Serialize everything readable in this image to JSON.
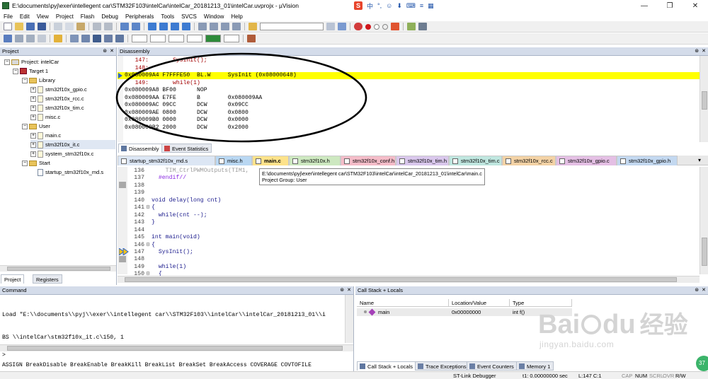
{
  "window": {
    "title": "E:\\documents\\pyj\\exer\\intellegent car\\STM32F103\\intelCar\\intelCar_20181213_01\\intelCar.uvprojx - µVision",
    "controls": [
      "—",
      "❐",
      "✕"
    ]
  },
  "ime": {
    "logo": "S",
    "lang": "中",
    "items": [
      "°,",
      "☺",
      "⬇",
      "⌨",
      "≡",
      "▦"
    ]
  },
  "menu": [
    "File",
    "Edit",
    "View",
    "Project",
    "Flash",
    "Debug",
    "Peripherals",
    "Tools",
    "SVCS",
    "Window",
    "Help"
  ],
  "project": {
    "header": "Project",
    "root": "Project: intelCar",
    "target": "Target 1",
    "groups": [
      {
        "name": "Library",
        "files": [
          "stm32f10x_gpio.c",
          "stm32f10x_rcc.c",
          "stm32f10x_tim.c",
          "misc.c"
        ]
      },
      {
        "name": "User",
        "files": [
          "main.c",
          "stm32f10x_it.c",
          "system_stm32f10x.c"
        ]
      },
      {
        "name": "Start",
        "files": [
          "startup_stm32f10x_md.s"
        ]
      }
    ],
    "bottom_tabs": [
      "Project",
      "Registers"
    ]
  },
  "disassembly": {
    "header": "Disassembly",
    "lines": [
      {
        "text": "   147:       SysInit();",
        "kind": "src"
      },
      {
        "text": "   148:",
        "kind": "src"
      },
      {
        "text": "0x080009A4 F7FFFE50  BL.W     SysInit (0x08000648)",
        "kind": "current"
      },
      {
        "text": "   149:       while(1)",
        "kind": "src"
      },
      {
        "text": "0x080009A8 BF00      NOP",
        "kind": "asm"
      },
      {
        "text": "0x080009AA E7FE      B        0x080009AA",
        "kind": "asm"
      },
      {
        "text": "0x080009AC 09CC      DCW      0x09CC",
        "kind": "asm"
      },
      {
        "text": "0x080009AE 0800      DCW      0x0800",
        "kind": "asm"
      },
      {
        "text": "0x080009B0 0000      DCW      0x0000",
        "kind": "asm"
      },
      {
        "text": "0x080009B2 2000      DCW      0x2000",
        "kind": "asm"
      }
    ],
    "tabs": [
      "Disassembly",
      "Event Statistics"
    ]
  },
  "file_tabs": [
    {
      "label": "startup_stm32f10x_md.s",
      "color": "#dce6f4"
    },
    {
      "label": "misc.h",
      "color": "#b9d7f2"
    },
    {
      "label": "main.c",
      "color": "#fde28a",
      "active": true
    },
    {
      "label": "stm32f10x.h",
      "color": "#cde8c0"
    },
    {
      "label": "stm32f10x_conf.h",
      "color": "#f4bcc8"
    },
    {
      "label": "stm32f10x_tim.h",
      "color": "#d9c7ec"
    },
    {
      "label": "stm32f10x_tim.c",
      "color": "#bfe6df"
    },
    {
      "label": "stm32f10x_rcc.c",
      "color": "#f3d2a5"
    },
    {
      "label": "stm32f10x_gpio.c",
      "color": "#e4bfe4"
    },
    {
      "label": "stm32f10x_gpio.h",
      "color": "#c3d8f0"
    }
  ],
  "editor": {
    "lines": [
      {
        "n": "136",
        "pre": "    ",
        "code": "TIM_CtrlPWMOutputs(TIM1,",
        "style": "faded"
      },
      {
        "n": "137",
        "pre": "  ",
        "code": "#endif//",
        "style": "pp"
      },
      {
        "n": "138",
        "pre": "",
        "code": "",
        "style": "plain"
      },
      {
        "n": "139",
        "pre": "",
        "code": "",
        "style": "plain"
      },
      {
        "n": "140",
        "pre": "",
        "code": "void delay(long cnt)",
        "style": "plain"
      },
      {
        "n": "141",
        "pre": "",
        "code": "{",
        "style": "plain"
      },
      {
        "n": "142",
        "pre": "  ",
        "code": "while(cnt --);",
        "style": "plain"
      },
      {
        "n": "143",
        "pre": "",
        "code": "}",
        "style": "plain"
      },
      {
        "n": "144",
        "pre": "",
        "code": "",
        "style": "plain"
      },
      {
        "n": "145",
        "pre": "",
        "code": "int main(void)",
        "style": "plain"
      },
      {
        "n": "146",
        "pre": "",
        "code": "{",
        "style": "plain"
      },
      {
        "n": "147",
        "pre": "  ",
        "code": "SysInit();",
        "style": "plain"
      },
      {
        "n": "148",
        "pre": "",
        "code": "",
        "style": "plain"
      },
      {
        "n": "149",
        "pre": "  ",
        "code": "while(1)",
        "style": "plain"
      },
      {
        "n": "150",
        "pre": "  ",
        "code": "{",
        "style": "plain"
      }
    ],
    "tooltip": {
      "path": "E:\\documents\\pyj\\exer\\intellegent car\\STM32F103\\intelCar\\intelCar_20181213_01\\intelCar\\main.c",
      "group": "Project Group: User"
    }
  },
  "command": {
    "header": "Command",
    "output": [
      "Load \"E:\\\\documents\\\\pyj\\\\exer\\\\intellegent car\\\\STM32F103\\\\intelCar\\\\intelCar_20181213_01\\\\i",
      "BS \\\\intelCar\\stm32f10x_it.c\\150, 1"
    ],
    "prompt": ">",
    "hint": "ASSIGN BreakDisable BreakEnable BreakKill BreakList BreakSet BreakAccess COVERAGE COVTOFILE"
  },
  "callstack": {
    "header": "Call Stack + Locals",
    "columns": [
      "Name",
      "Location/Value",
      "Type"
    ],
    "rows": [
      {
        "name": "main",
        "location": "0x00000000",
        "type": "int f()"
      }
    ],
    "tabs": [
      "Call Stack + Locals",
      "Trace Exceptions",
      "Event Counters",
      "Memory 1"
    ]
  },
  "watermark": {
    "brand": "Bai",
    "brand2": "du",
    "cn": "经验",
    "url": "jingyan.baidu.com"
  },
  "status": {
    "debugger": "ST-Link Debugger",
    "time": "t1: 0.00000000 sec",
    "pos": "L:147 C:1",
    "indicators": [
      "CAP",
      "NUM",
      "SCRL",
      "OVR",
      "R/W"
    ]
  },
  "corner_badge": "37",
  "colors": {
    "current_line": "#ffff00",
    "annotation": "#000000"
  }
}
